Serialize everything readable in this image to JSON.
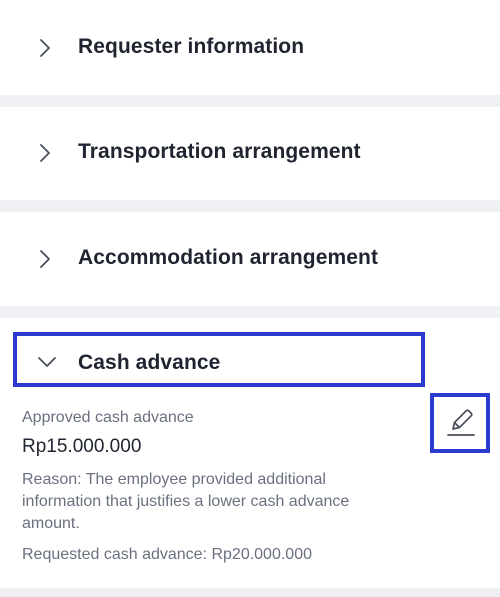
{
  "sections": [
    {
      "title": "Requester information",
      "state": "collapsed",
      "icon": "chevron-right-icon"
    },
    {
      "title": "Transportation arrangement",
      "state": "collapsed",
      "icon": "chevron-right-icon"
    },
    {
      "title": "Accommodation arrangement",
      "state": "collapsed",
      "icon": "chevron-right-icon"
    }
  ],
  "cash_advance": {
    "title": "Cash advance",
    "state": "expanded",
    "icon": "chevron-down-icon",
    "edit_icon": "pencil-icon",
    "approved_label": "Approved cash advance",
    "approved_amount": "Rp15.000.000",
    "reason": "Reason: The employee provided additional information that justifies a lower cash advance amount.",
    "requested_text": "Requested cash advance: Rp20.000.000"
  },
  "colors": {
    "highlight_border": "#2b3acf",
    "background": "#eff1f4",
    "text_primary": "#1f2430",
    "text_muted": "#6a7080"
  }
}
